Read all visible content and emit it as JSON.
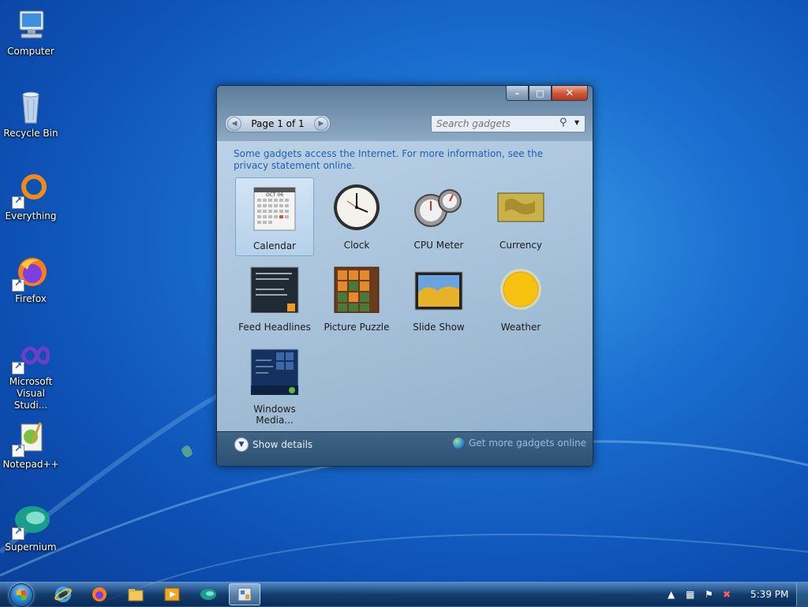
{
  "desktop": {
    "icons": [
      {
        "label": "Computer",
        "icon": "computer-icon"
      },
      {
        "label": "Recycle Bin",
        "icon": "recycle-bin-icon"
      },
      {
        "label": "Everything",
        "icon": "everything-icon"
      },
      {
        "label": "Firefox",
        "icon": "firefox-icon"
      },
      {
        "label": "Microsoft Visual Studi...",
        "icon": "visual-studio-icon"
      },
      {
        "label": "Notepad++",
        "icon": "notepad-plus-plus-icon"
      },
      {
        "label": "Supernium",
        "icon": "supernium-icon"
      }
    ]
  },
  "window": {
    "pager_text": "Page 1 of 1",
    "search_placeholder": "Search gadgets",
    "notice_text": "Some gadgets access the Internet.  For more information, see the privacy statement online.",
    "gadgets": [
      {
        "label": "Calendar",
        "icon": "calendar-gadget-icon",
        "selected": true
      },
      {
        "label": "Clock",
        "icon": "clock-gadget-icon"
      },
      {
        "label": "CPU Meter",
        "icon": "cpu-meter-gadget-icon"
      },
      {
        "label": "Currency",
        "icon": "currency-gadget-icon"
      },
      {
        "label": "Feed Headlines",
        "icon": "feed-headlines-gadget-icon"
      },
      {
        "label": "Picture Puzzle",
        "icon": "picture-puzzle-gadget-icon"
      },
      {
        "label": "Slide Show",
        "icon": "slide-show-gadget-icon"
      },
      {
        "label": "Weather",
        "icon": "weather-gadget-icon"
      },
      {
        "label": "Windows Media...",
        "icon": "windows-media-center-gadget-icon"
      }
    ],
    "calendar_month": "OCT 06",
    "show_details": "Show details",
    "more_online": "Get more gadgets online"
  },
  "taskbar": {
    "clock": "5:39 PM",
    "pinned": [
      "internet-explorer-icon",
      "firefox-icon",
      "file-explorer-icon",
      "media-player-icon",
      "supernium-icon",
      "gadget-gallery-icon"
    ]
  },
  "colors": {
    "accent": "#1d5fb5",
    "link": "#8fbde8",
    "desktop": "#1a6fd0"
  }
}
